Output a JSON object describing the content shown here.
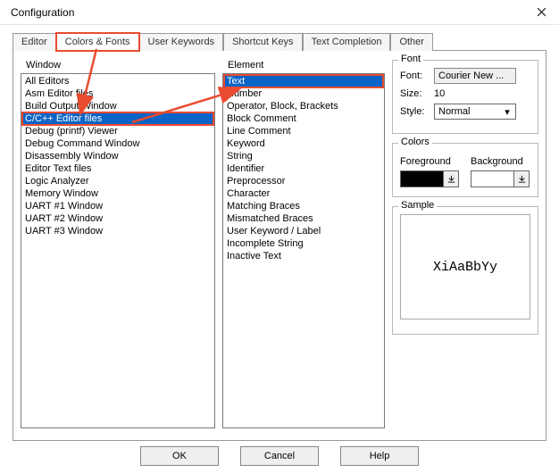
{
  "window_title": "Configuration",
  "tabs": [
    "Editor",
    "Colors & Fonts",
    "User Keywords",
    "Shortcut Keys",
    "Text Completion",
    "Other"
  ],
  "selected_tab_index": 1,
  "window_group_label": "Window",
  "element_group_label": "Element",
  "window_items": [
    "All Editors",
    "Asm Editor files",
    "Build Output Window",
    "C/C++ Editor files",
    "Debug (printf) Viewer",
    "Debug Command Window",
    "Disassembly Window",
    "Editor Text files",
    "Logic Analyzer",
    "Memory Window",
    "UART #1 Window",
    "UART #2 Window",
    "UART #3 Window"
  ],
  "window_selected_index": 3,
  "element_items": [
    "Text",
    "Number",
    "Operator, Block, Brackets",
    "Block Comment",
    "Line Comment",
    "Keyword",
    "String",
    "Identifier",
    "Preprocessor",
    "Character",
    "Matching Braces",
    "Mismatched Braces",
    "User Keyword / Label",
    "Incomplete String",
    "Inactive Text"
  ],
  "element_selected_index": 0,
  "font_group": {
    "legend": "Font",
    "font_label": "Font:",
    "font_value": "Courier New ...",
    "size_label": "Size:",
    "size_value": "10",
    "style_label": "Style:",
    "style_value": "Normal"
  },
  "colors_group": {
    "legend": "Colors",
    "foreground_label": "Foreground",
    "background_label": "Background"
  },
  "sample_group": {
    "legend": "Sample",
    "text": "XiAaBbYy"
  },
  "footer": {
    "ok": "OK",
    "cancel": "Cancel",
    "help": "Help"
  }
}
